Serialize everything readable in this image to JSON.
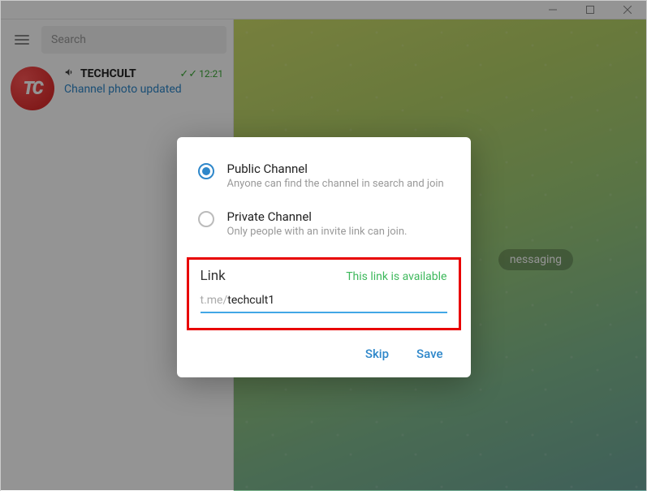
{
  "window": {
    "minimize_aria": "Minimize",
    "maximize_aria": "Maximize",
    "close_aria": "Close"
  },
  "sidebar": {
    "search_placeholder": "Search",
    "chat": {
      "avatar_letters": "TC",
      "title": "TECHCULT",
      "time": "12:21",
      "subtitle": "Channel photo updated"
    }
  },
  "main": {
    "badge_partial": "nessaging"
  },
  "dialog": {
    "options": {
      "public": {
        "title": "Public Channel",
        "desc": "Anyone can find the channel in search and join"
      },
      "private": {
        "title": "Private Channel",
        "desc": "Only people with an invite link can join."
      }
    },
    "link": {
      "label": "Link",
      "status": "This link is available",
      "prefix": "t.me/",
      "value": "techcult1"
    },
    "actions": {
      "skip": "Skip",
      "save": "Save"
    }
  }
}
